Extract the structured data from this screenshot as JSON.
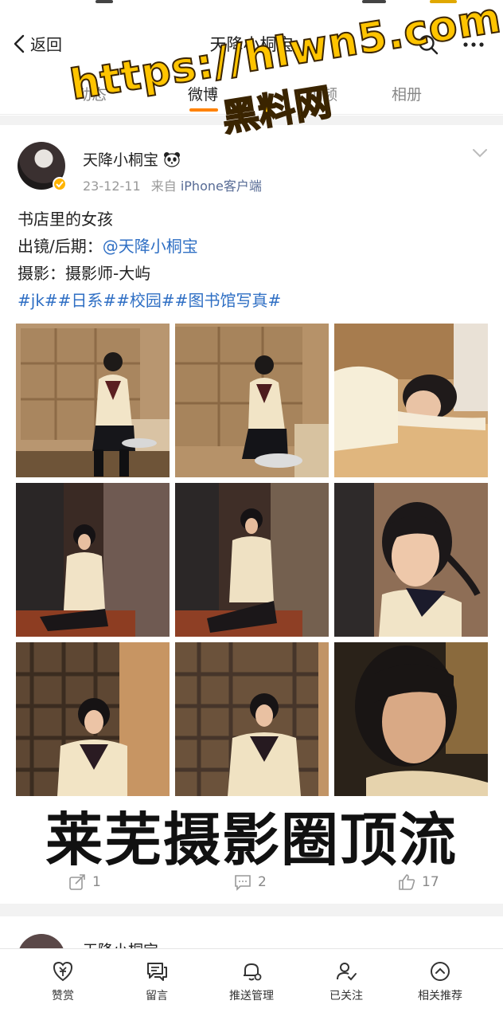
{
  "nav": {
    "back_label": "返回",
    "title": "天降小桐宝"
  },
  "tabs": [
    {
      "label": "动态",
      "active": false
    },
    {
      "label": "微博",
      "active": true
    },
    {
      "label": "视频",
      "active": false
    },
    {
      "label": "相册",
      "active": false
    }
  ],
  "post": {
    "author": "天降小桐宝",
    "date": "23-12-11",
    "source_prefix": "来自",
    "source": "iPhone客户端",
    "line1": "书店里的女孩",
    "line2_label": "出镜/后期：",
    "line2_mention": "@天降小桐宝",
    "line3": "摄影：摄影师-大屿",
    "hashtags": "#jk##日系##校园##图书馆写真#",
    "photo_count": 9
  },
  "overlay_caption": "莱芜摄影圈顶流",
  "watermark": {
    "url": "https://hlwn5.com",
    "name": "黑料网"
  },
  "actions": {
    "repost_count": "1",
    "comment_count": "2",
    "like_count": "17"
  },
  "next_post": {
    "author": "天降小桐宝"
  },
  "bottombar": {
    "items": [
      "赞赏",
      "留言",
      "推送管理",
      "已关注",
      "相关推荐"
    ]
  },
  "colors": {
    "accent": "#ff8200",
    "link": "#2f6fc4",
    "watermark": "#ffc400"
  }
}
